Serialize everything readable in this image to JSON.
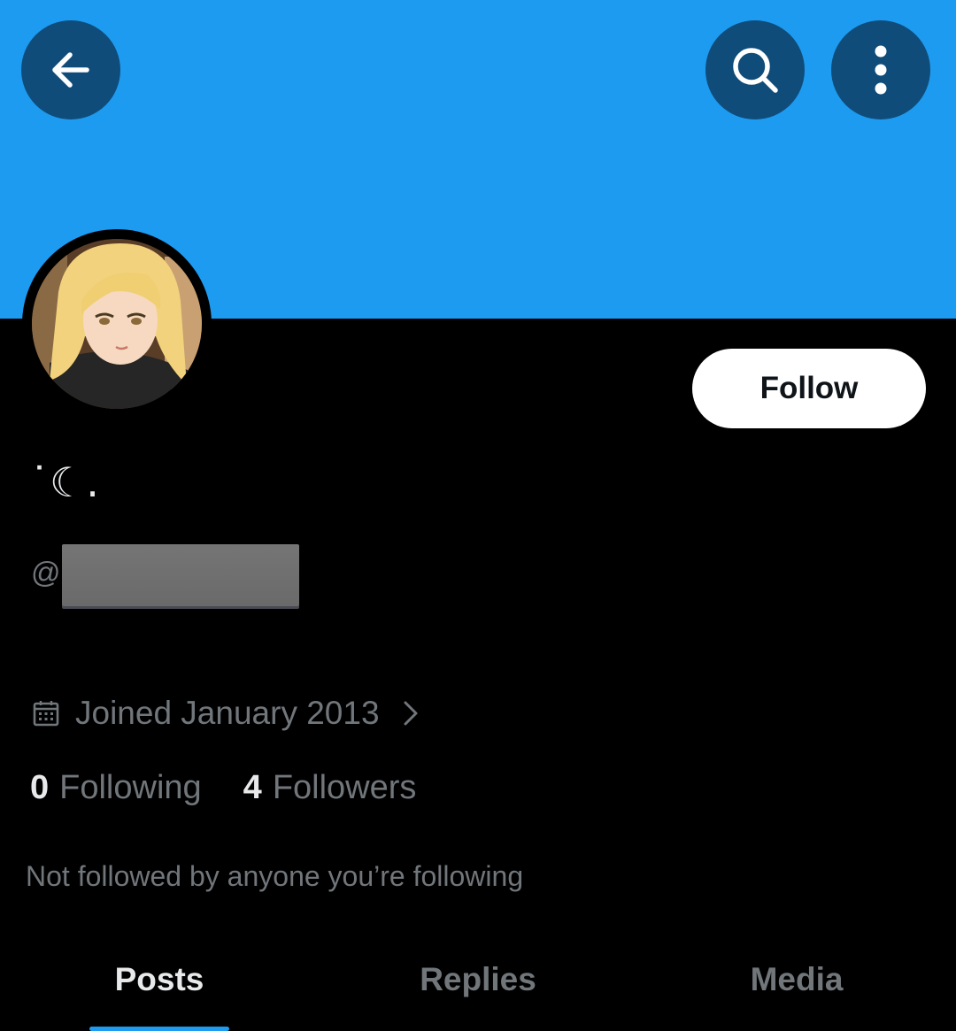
{
  "header": {
    "back_icon": "arrow-left-icon",
    "search_icon": "search-icon",
    "more_icon": "more-vertical-icon",
    "banner_color": "#1d9bf0",
    "button_color": "#0f4c7a"
  },
  "profile": {
    "display_name": "˙☾.",
    "handle_prefix": "@",
    "handle_redacted": true,
    "follow_label": "Follow",
    "joined_icon": "calendar-icon",
    "joined_text": "Joined January 2013",
    "following_count": "0",
    "following_label": "Following",
    "followers_count": "4",
    "followers_label": "Followers",
    "followed_by_text": "Not followed by anyone you’re following"
  },
  "tabs": [
    {
      "label": "Posts",
      "active": true
    },
    {
      "label": "Replies",
      "active": false
    },
    {
      "label": "Media",
      "active": false
    }
  ]
}
